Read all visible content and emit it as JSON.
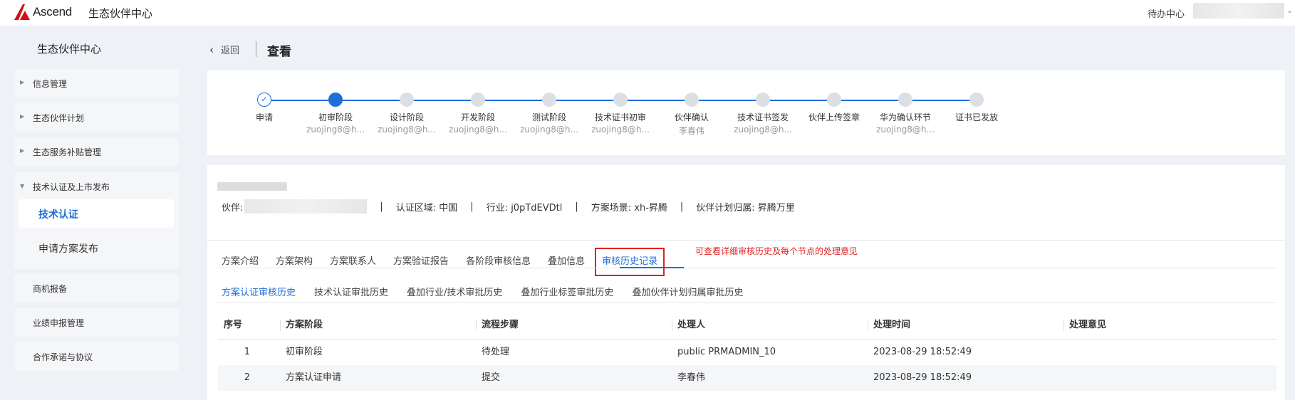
{
  "header": {
    "logo_text": "Ascend",
    "app_title": "生态伙伴中心",
    "todo_label": "待办中心"
  },
  "sidebar": {
    "title": "生态伙伴中心",
    "items": [
      {
        "label": "信息管理"
      },
      {
        "label": "生态伙伴计划"
      },
      {
        "label": "生态服务补贴管理"
      },
      {
        "label": "技术认证及上市发布",
        "children": [
          {
            "label": "技术认证",
            "active": true
          },
          {
            "label": "申请方案发布"
          }
        ]
      },
      {
        "label": "商机报备"
      },
      {
        "label": "业绩申报管理"
      },
      {
        "label": "合作承诺与协议"
      }
    ]
  },
  "page": {
    "back_label": "返回",
    "title": "查看"
  },
  "stepper": {
    "steps": [
      {
        "name": "申请",
        "sub": "",
        "status": "done"
      },
      {
        "name": "初审阶段",
        "sub": "zuojing8@h...",
        "status": "current"
      },
      {
        "name": "设计阶段",
        "sub": "zuojing8@h...",
        "status": "pending"
      },
      {
        "name": "开发阶段",
        "sub": "zuojing8@h...",
        "status": "pending"
      },
      {
        "name": "测试阶段",
        "sub": "zuojing8@h...",
        "status": "pending"
      },
      {
        "name": "技术证书初审",
        "sub": "zuojing8@h...",
        "status": "pending"
      },
      {
        "name": "伙伴确认",
        "sub": "李春伟",
        "status": "pending"
      },
      {
        "name": "技术证书签发",
        "sub": "zuojing8@h...",
        "status": "pending"
      },
      {
        "name": "伙伴上传签章",
        "sub": "",
        "status": "pending"
      },
      {
        "name": "华为确认环节",
        "sub": "zuojing8@h...",
        "status": "pending"
      },
      {
        "name": "证书已发放",
        "sub": "",
        "status": "pending"
      }
    ],
    "done_icon": "check-icon"
  },
  "info": {
    "partner_label": "伙伴:",
    "region": "认证区域: 中国",
    "industry": "行业: j0pTdEVDtl",
    "scene": "方案场景: xh-昇腾",
    "plan": "伙伴计划归属: 昇腾万里",
    "separator": "|"
  },
  "tabs": {
    "items": [
      "方案介绍",
      "方案架构",
      "方案联系人",
      "方案验证报告",
      "各阶段审核信息",
      "叠加信息",
      "审核历史记录"
    ],
    "active_index": 6,
    "note": "可查看详细审核历史及每个节点的处理意见"
  },
  "subtabs": {
    "items": [
      "方案认证审核历史",
      "技术认证审批历史",
      "叠加行业/技术审批历史",
      "叠加行业标签审批历史",
      "叠加伙伴计划归属审批历史"
    ],
    "active_index": 0
  },
  "table": {
    "columns": [
      "序号",
      "方案阶段",
      "流程步骤",
      "处理人",
      "处理时间",
      "处理意见"
    ],
    "rows": [
      [
        "1",
        "初审阶段",
        "待处理",
        "public PRMADMIN_10",
        "2023-08-29 18:52:49",
        ""
      ],
      [
        "2",
        "方案认证申请",
        "提交",
        "李春伟",
        "2023-08-29 18:52:49",
        ""
      ]
    ]
  },
  "colors": {
    "accent": "#1f6fd9",
    "highlight": "#e02020",
    "logo_red": "#d0121b"
  }
}
